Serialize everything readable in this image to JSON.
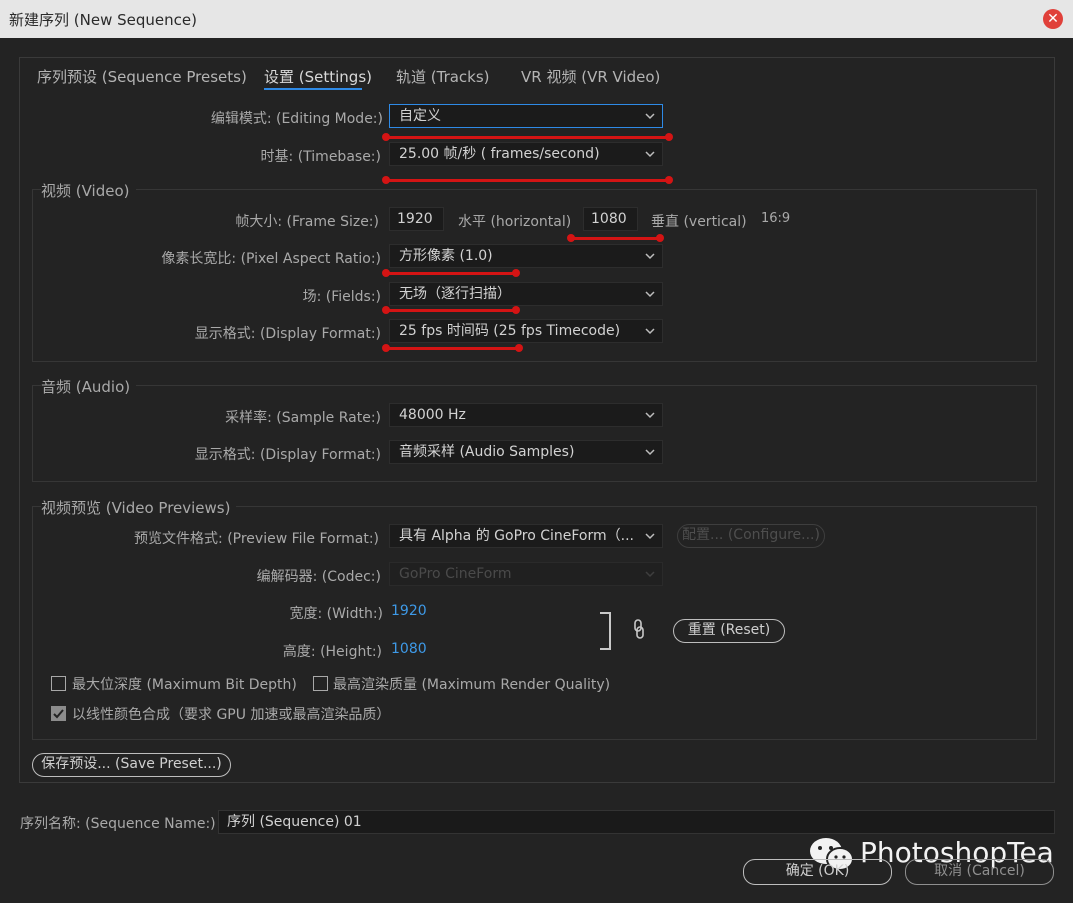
{
  "window": {
    "title": "新建序列 (New Sequence)"
  },
  "tabs": [
    {
      "label": "序列预设 (Sequence Presets)"
    },
    {
      "label": "设置 (Settings)"
    },
    {
      "label": "轨道 (Tracks)"
    },
    {
      "label": "VR 视频 (VR Video)"
    }
  ],
  "settings": {
    "editing_mode": {
      "label": "编辑模式: (Editing Mode:)",
      "value": "自定义"
    },
    "timebase": {
      "label": "时基: (Timebase:)",
      "value": "25.00  帧/秒 ( frames/second)"
    }
  },
  "video": {
    "title": "视频 (Video)",
    "frame_size": {
      "label": "帧大小: (Frame Size:)",
      "width": "1920",
      "horizontal_label": "水平 (horizontal)",
      "height": "1080",
      "vertical_label": "垂直 (vertical)",
      "aspect": "16:9"
    },
    "pixel_aspect": {
      "label": "像素长宽比: (Pixel Aspect Ratio:)",
      "value": "方形像素 (1.0)"
    },
    "fields": {
      "label": "场: (Fields:)",
      "value": "无场（逐行扫描）"
    },
    "display_format": {
      "label": "显示格式: (Display Format:)",
      "value": "25 fps 时间码 (25 fps Timecode)"
    }
  },
  "audio": {
    "title": "音频 (Audio)",
    "sample_rate": {
      "label": "采样率: (Sample Rate:)",
      "value": "48000 Hz"
    },
    "display_format": {
      "label": "显示格式: (Display Format:)",
      "value": "音频采样 (Audio Samples)"
    }
  },
  "previews": {
    "title": "视频预览 (Video Previews)",
    "file_format": {
      "label": "预览文件格式: (Preview File Format:)",
      "value": "具有  Alpha 的  GoPro  CineForm（..."
    },
    "configure_label": "配置... (Configure...)",
    "codec": {
      "label": "编解码器: (Codec:)",
      "value": "GoPro CineForm"
    },
    "width": {
      "label": "宽度: (Width:)",
      "value": "1920"
    },
    "height": {
      "label": "高度: (Height:)",
      "value": "1080"
    },
    "reset_label": "重置 (Reset)"
  },
  "options": {
    "max_bit_depth": {
      "label": "最大位深度 (Maximum Bit Depth)",
      "checked": false
    },
    "max_render_quality": {
      "label": "最高渲染质量 (Maximum Render Quality)",
      "checked": false
    },
    "linear_color": {
      "label": "以线性颜色合成（要求 GPU 加速或最高渲染品质）",
      "checked": true
    }
  },
  "save_preset_label": "保存预设... (Save Preset...)",
  "sequence_name": {
    "label": "序列名称: (Sequence Name:)",
    "value": "序列 (Sequence) 01"
  },
  "footer": {
    "ok_label": "确定 (OK)",
    "cancel_label": "取消 (Cancel)"
  },
  "watermark": {
    "text": "PhotoshopTea"
  },
  "colors": {
    "accent": "#2e8ae6",
    "annotation_red": "#d41414",
    "link_blue": "#3e9ae8",
    "background": "#232323"
  }
}
